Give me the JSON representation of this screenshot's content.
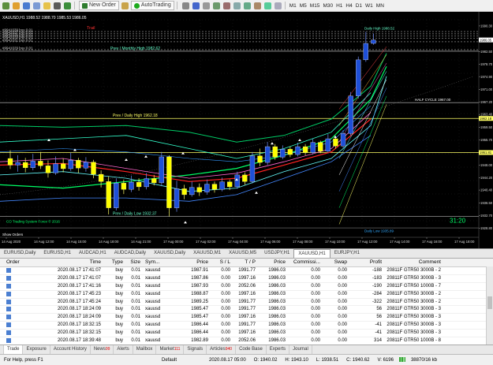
{
  "toolbar": {
    "new_order_label": "New Order",
    "auto_trading_label": "AutoTrading",
    "timeframes": [
      "M1",
      "M5",
      "M15",
      "M30",
      "H1",
      "H4",
      "D1",
      "W1",
      "MN"
    ]
  },
  "chart": {
    "symbol_header": "XAUUSD,H1  1988.52 1988.70 1985.53 1986.05",
    "orders": [
      "#9941039 buy 0.01",
      "#9941037 buy 0.01",
      "#9941035 buy 0.01",
      "#9941033 buy 0.01",
      "#9941031 buy 0.01",
      "#9941029 buy 0.01"
    ],
    "trail_label": "Trail",
    "prev_monthly_high": "Prev / Monthly High 1982.62",
    "prev_daily_high": "Prev / Daily High 1962.18",
    "prev_daily_low": "Prev / Daily Low 1932.37",
    "half_cycle": "HALF CYCLE 1967.00",
    "daily_high_tag": "Daily High 1988.52",
    "daily_low_tag": "Daily Low 1935.89",
    "show_orders": "Show Orders",
    "watermark": "CO Trading System Forex © 2016",
    "countdown": "31:20",
    "prices": [
      "1990.30",
      "1986.05",
      "1982.50",
      "1978.70",
      "1974.90",
      "1971.00",
      "1967.20",
      "1963.40",
      "1959.50",
      "1955.70",
      "1951.90",
      "1948.00",
      "1944.20",
      "1940.40",
      "1936.50",
      "1932.70",
      "1928.80"
    ],
    "price_tags": [
      {
        "label": "1986.05",
        "color": "#ffffff"
      },
      {
        "label": "1962.18",
        "color": "#ffff66"
      },
      {
        "label": "1951.81",
        "color": "#ffff66"
      }
    ],
    "times": [
      "14 Aug 2020",
      "14 Aug 12:00",
      "14 Aug 15:00",
      "14 Aug 18:00",
      "14 Aug 21:00",
      "17 Aug 00:00",
      "17 Aug 02:00",
      "17 Aug 04:00",
      "17 Aug 06:00",
      "17 Aug 08:00",
      "17 Aug 10:00",
      "17 Aug 12:00",
      "17 Aug 14:00",
      "17 Aug 16:00",
      "17 Aug 18:00"
    ],
    "candles": [
      [
        1950.0,
        1948.0,
        1952.5,
        1946.8
      ],
      [
        1948.0,
        1948.8,
        1951.0,
        1946.0
      ],
      [
        1948.8,
        1947.2,
        1950.2,
        1945.8
      ],
      [
        1947.2,
        1949.2,
        1951.4,
        1946.4
      ],
      [
        1949.2,
        1947.8,
        1952.0,
        1946.8
      ],
      [
        1947.8,
        1945.6,
        1949.4,
        1944.2
      ],
      [
        1945.6,
        1948.4,
        1950.6,
        1945.0
      ],
      [
        1948.4,
        1946.9,
        1950.0,
        1945.8
      ],
      [
        1946.9,
        1949.5,
        1951.8,
        1946.2
      ],
      [
        1949.5,
        1947.1,
        1950.2,
        1945.6
      ],
      [
        1947.1,
        1948.9,
        1950.4,
        1946.0
      ],
      [
        1948.9,
        1945.2,
        1949.6,
        1944.0
      ],
      [
        1945.2,
        1943.0,
        1946.4,
        1941.2
      ],
      [
        1943.0,
        1935.0,
        1944.6,
        1933.0
      ],
      [
        1935.0,
        1942.5,
        1944.0,
        1934.2
      ],
      [
        1942.5,
        1940.6,
        1943.6,
        1939.2
      ],
      [
        1940.6,
        1942.8,
        1944.8,
        1939.8
      ],
      [
        1942.8,
        1941.4,
        1944.0,
        1940.2
      ],
      [
        1941.4,
        1943.9,
        1945.6,
        1940.6
      ],
      [
        1943.9,
        1942.6,
        1945.0,
        1941.8
      ],
      [
        1942.6,
        1950.5,
        1952.0,
        1941.6
      ],
      [
        1950.5,
        1935.0,
        1951.0,
        1932.4
      ],
      [
        1935.0,
        1940.8,
        1943.2,
        1933.8
      ],
      [
        1940.8,
        1939.0,
        1942.0,
        1937.6
      ],
      [
        1939.0,
        1941.2,
        1943.0,
        1938.4
      ],
      [
        1941.2,
        1939.8,
        1942.4,
        1938.6
      ],
      [
        1939.8,
        1942.2,
        1943.6,
        1939.0
      ],
      [
        1942.2,
        1940.6,
        1943.0,
        1939.6
      ],
      [
        1940.6,
        1942.9,
        1944.2,
        1940.0
      ],
      [
        1942.9,
        1941.4,
        1943.6,
        1940.4
      ],
      [
        1941.4,
        1945.0,
        1946.0,
        1940.8
      ],
      [
        1945.0,
        1943.0,
        1945.8,
        1942.0
      ],
      [
        1943.0,
        1950.8,
        1952.0,
        1942.4
      ],
      [
        1950.8,
        1948.8,
        1953.0,
        1947.6
      ],
      [
        1948.8,
        1953.6,
        1955.0,
        1948.0
      ],
      [
        1953.6,
        1950.4,
        1954.4,
        1949.6
      ],
      [
        1950.4,
        1952.8,
        1954.0,
        1949.8
      ],
      [
        1952.8,
        1951.2,
        1953.6,
        1950.4
      ],
      [
        1951.2,
        1953.6,
        1954.8,
        1950.6
      ],
      [
        1953.6,
        1951.8,
        1954.4,
        1951.0
      ],
      [
        1951.8,
        1954.9,
        1956.0,
        1951.2
      ],
      [
        1954.9,
        1952.2,
        1955.4,
        1951.6
      ],
      [
        1952.2,
        1956.0,
        1957.4,
        1951.8
      ],
      [
        1956.0,
        1953.8,
        1956.8,
        1953.0
      ],
      [
        1953.8,
        1957.6,
        1958.6,
        1953.2
      ],
      [
        1957.6,
        1969.0,
        1970.2,
        1957.0
      ],
      [
        1969.0,
        1980.0,
        1981.0,
        1968.2
      ],
      [
        1980.0,
        1985.0,
        1988.5,
        1979.4
      ],
      [
        1985.0,
        1986.05,
        1988.0,
        1984.6
      ]
    ]
  },
  "chart_tabs": [
    "EURUSD,Daily",
    "EURUSD,H1",
    "AUDCAD,H1",
    "AUDCAD,Daily",
    "XAUUSD,Daily",
    "XAUUSD,M1",
    "XAUUSD,M5",
    "USDJPY,H1",
    "XAUUSD,H1",
    "EURJPY,H1"
  ],
  "active_chart_tab": "XAUUSD,H1",
  "terminal": {
    "headers": [
      "Order",
      "Time",
      "Type",
      "Size",
      "Sym...",
      "Price",
      "S / L",
      "T / P",
      "Price",
      "Commissi...",
      "Swap",
      "Profit",
      "Comment"
    ],
    "rows": [
      [
        "",
        "2020.08.17 17:41:07",
        "buy",
        "0.01",
        "xauusd",
        "1987.91",
        "0.00",
        "1991.77",
        "1986.03",
        "0.00",
        "0.00",
        "-188",
        "20811F GTR50 3000B - 2"
      ],
      [
        "",
        "2020.08.17 17:41:07",
        "buy",
        "0.01",
        "xauusd",
        "1987.86",
        "0.00",
        "1997.16",
        "1986.03",
        "0.00",
        "0.00",
        "-183",
        "20811F GTR50 3000B - 3"
      ],
      [
        "",
        "2020.08.17 17:41:16",
        "buy",
        "0.01",
        "xauusd",
        "1987.93",
        "0.00",
        "2052.06",
        "1986.03",
        "0.00",
        "0.00",
        "-190",
        "20811F GTR50 1000B - 7"
      ],
      [
        "",
        "2020.08.17 17:45:23",
        "buy",
        "0.01",
        "xauusd",
        "1988.87",
        "0.00",
        "1997.16",
        "1986.03",
        "0.00",
        "0.00",
        "-284",
        "20811F GTR50 3000B - 2"
      ],
      [
        "",
        "2020.08.17 17:45:24",
        "buy",
        "0.01",
        "xauusd",
        "1989.25",
        "0.00",
        "1991.77",
        "1986.03",
        "0.00",
        "0.00",
        "-322",
        "20811F GTR50 3000B - 2"
      ],
      [
        "",
        "2020.08.17 18:24:09",
        "buy",
        "0.01",
        "xauusd",
        "1985.47",
        "0.00",
        "1991.77",
        "1986.03",
        "0.00",
        "0.00",
        "56",
        "20811F GTR50 3000B - 3"
      ],
      [
        "",
        "2020.08.17 18:24:09",
        "buy",
        "0.01",
        "xauusd",
        "1985.47",
        "0.00",
        "1997.16",
        "1986.03",
        "0.00",
        "0.00",
        "56",
        "20811F GTR50 3000B - 3"
      ],
      [
        "",
        "2020.08.17 18:32:15",
        "buy",
        "0.01",
        "xauusd",
        "1986.44",
        "0.00",
        "1991.77",
        "1986.03",
        "0.00",
        "0.00",
        "-41",
        "20811F GTR50 3000B - 3"
      ],
      [
        "",
        "2020.08.17 18:32:15",
        "buy",
        "0.01",
        "xauusd",
        "1986.44",
        "0.00",
        "1997.16",
        "1986.03",
        "0.00",
        "0.00",
        "-41",
        "20811F GTR50 3000B - 3"
      ],
      [
        "",
        "2020.08.17 18:39:48",
        "buy",
        "0.01",
        "xauusd",
        "1982.89",
        "0.00",
        "2052.06",
        "1986.03",
        "0.00",
        "0.00",
        "314",
        "20811F GTR50 1000B - 8"
      ]
    ]
  },
  "bottom_tabs": [
    {
      "label": "Trade",
      "badge": ""
    },
    {
      "label": "Exposure",
      "badge": ""
    },
    {
      "label": "Account History",
      "badge": ""
    },
    {
      "label": "News",
      "badge": "99"
    },
    {
      "label": "Alerts",
      "badge": ""
    },
    {
      "label": "Mailbox",
      "badge": ""
    },
    {
      "label": "Market",
      "badge": "111"
    },
    {
      "label": "Signals",
      "badge": ""
    },
    {
      "label": "Articles",
      "badge": "940"
    },
    {
      "label": "Code Base",
      "badge": ""
    },
    {
      "label": "Experts",
      "badge": ""
    },
    {
      "label": "Journal",
      "badge": ""
    }
  ],
  "status": {
    "help": "For Help, press F1",
    "profile": "Default",
    "datetime": "2020.08.17 05:00",
    "open": "O: 1940.02",
    "high": "H: 1943.10",
    "low": "L: 1938.51",
    "close": "C: 1940.62",
    "volume": "V: 6196",
    "traffic": "38870/16 kb"
  },
  "colors": {
    "bull": "#1e4fd8",
    "bear": "#ffff00",
    "chart_bg": "#000000"
  }
}
